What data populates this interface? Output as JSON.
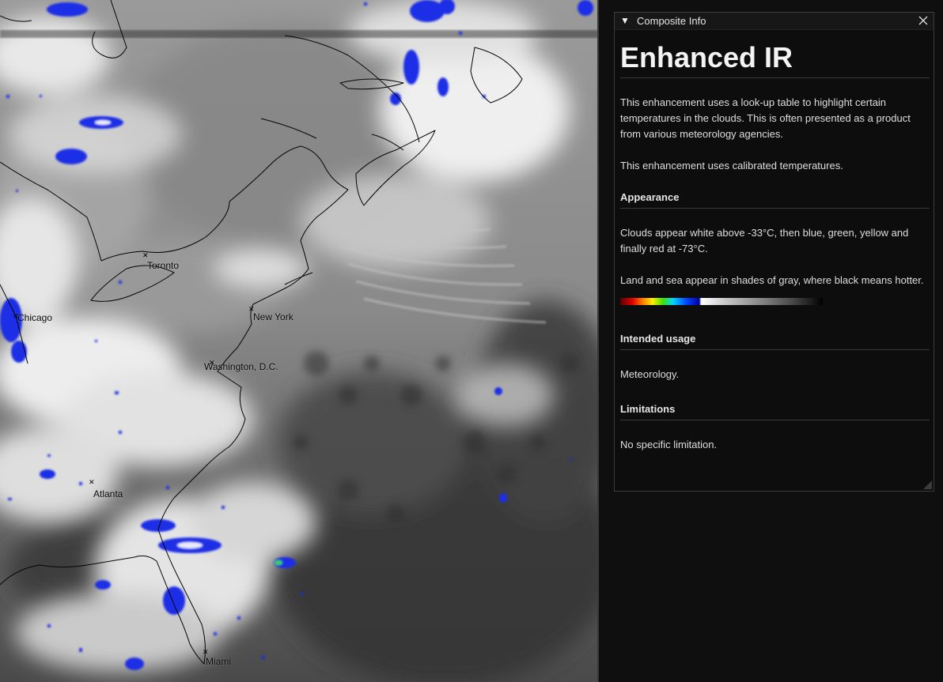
{
  "map": {
    "cities": [
      {
        "name": "Toronto"
      },
      {
        "name": "Chicago"
      },
      {
        "name": "New York"
      },
      {
        "name": "Washington, D.C."
      },
      {
        "name": "Atlanta"
      },
      {
        "name": "Miami"
      }
    ]
  },
  "panel": {
    "window_title": "Composite Info",
    "heading": "Enhanced IR",
    "intro": "This enhancement uses a look-up table to highlight certain temperatures in the clouds. This is often presented as a product from various meteorology agencies.",
    "calibration_note": "This enhancement uses calibrated temperatures.",
    "sections": {
      "appearance": {
        "title": "Appearance",
        "paragraph1": "Clouds appear white above -33°C, then blue, green, yellow and finally red at -73°C.",
        "paragraph2": "Land and sea appear in shades of gray, where black means hotter."
      },
      "intended_usage": {
        "title": "Intended usage",
        "text": "Meteorology."
      },
      "limitations": {
        "title": "Limitations",
        "text": "No specific limitation."
      }
    }
  },
  "colors": {
    "background": "#0f0f0f",
    "panel": "#0d0d0d",
    "text": "#dedede",
    "cloud_cold": "#1030e0"
  },
  "icons": {
    "collapse": "triangle-down-icon",
    "close": "close-x-icon",
    "resize": "resize-grip-icon"
  }
}
